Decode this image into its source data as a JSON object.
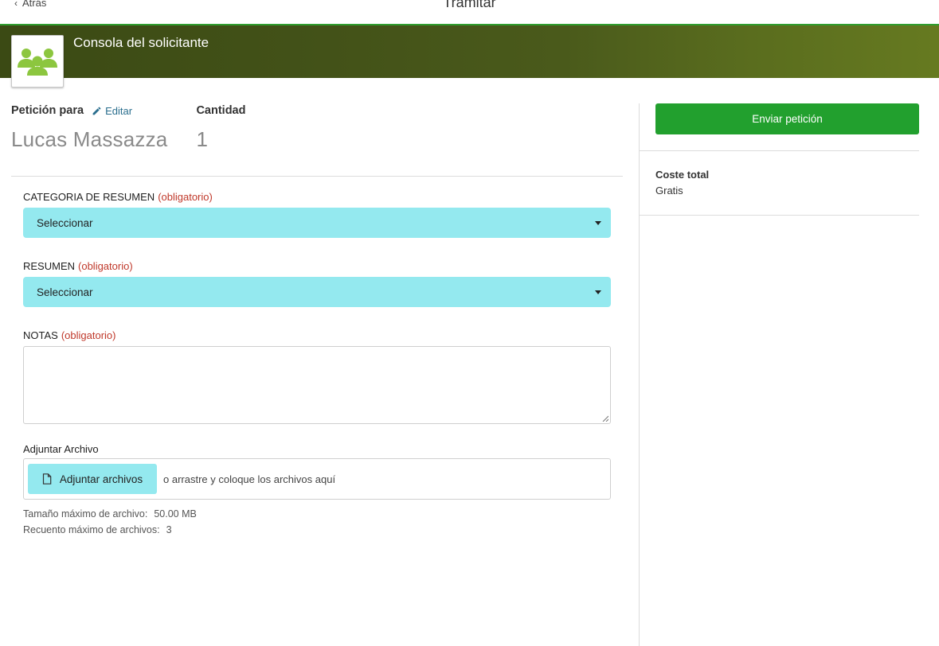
{
  "header": {
    "back_label": "Atrás",
    "title": "Tramitar"
  },
  "banner": {
    "title": "Consola del solicitante",
    "icon": "users-group-icon"
  },
  "request": {
    "for_label": "Petición para",
    "edit_label": "Editar",
    "for_value": "Lucas Massazza",
    "quantity_label": "Cantidad",
    "quantity_value": "1"
  },
  "form": {
    "category": {
      "label": "CATEGORIA DE RESUMEN",
      "required": "(obligatorio)",
      "value": "Seleccionar"
    },
    "summary": {
      "label": "RESUMEN",
      "required": "(obligatorio)",
      "value": "Seleccionar"
    },
    "notes": {
      "label": "NOTAS",
      "required": "(obligatorio)",
      "value": ""
    },
    "attachments": {
      "label": "Adjuntar Archivo",
      "button_label": "Adjuntar archivos",
      "hint": "o arrastre y coloque los archivos aquí",
      "max_size_label": "Tamaño máximo de archivo:",
      "max_size_value": "50.00 MB",
      "max_count_label": "Recuento máximo de archivos:",
      "max_count_value": "3"
    }
  },
  "sidebar": {
    "submit_label": "Enviar petición",
    "total_label": "Coste total",
    "total_value": "Gratis"
  },
  "colors": {
    "accent_green": "#22a02e",
    "select_bg": "#94e9ef",
    "required_red": "#c0392b",
    "link_blue": "#2a6e8e",
    "banner_dark": "#3b4a14",
    "banner_light": "#667a20",
    "icon_green": "#8cc63f"
  }
}
